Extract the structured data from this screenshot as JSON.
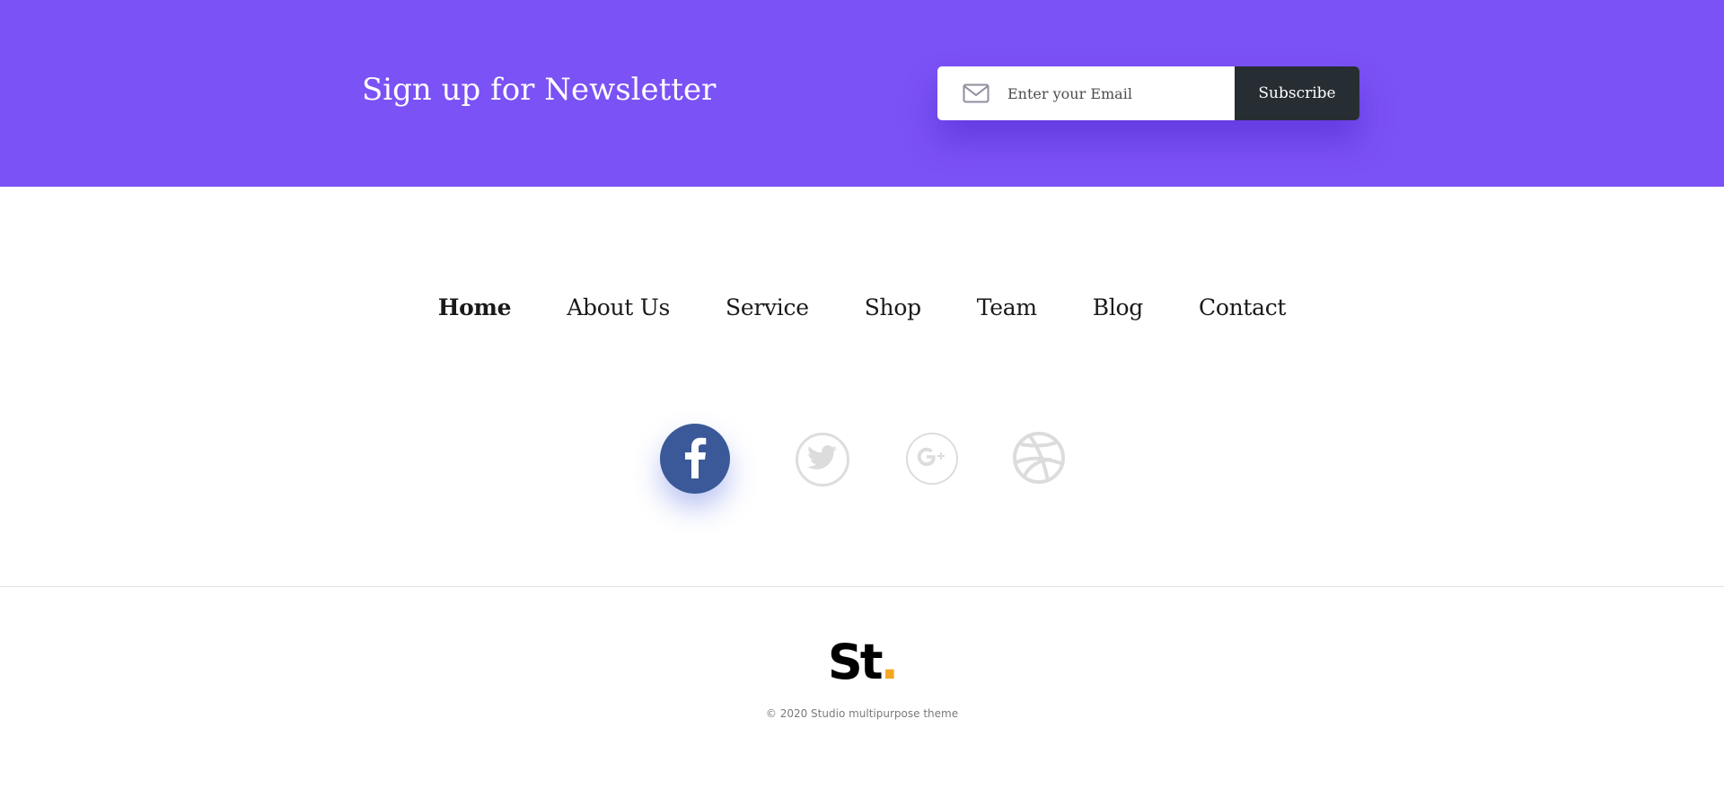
{
  "newsletter": {
    "title": "Sign up for Newsletter",
    "email_placeholder": "Enter your Email",
    "email_value": "",
    "subscribe_label": "Subscribe",
    "background_color": "#7b52f5",
    "button_color": "#262d33"
  },
  "nav": {
    "items": [
      {
        "label": "Home",
        "active": true
      },
      {
        "label": "About Us",
        "active": false
      },
      {
        "label": "Service",
        "active": false
      },
      {
        "label": "Shop",
        "active": false
      },
      {
        "label": "Team",
        "active": false
      },
      {
        "label": "Blog",
        "active": false
      },
      {
        "label": "Contact",
        "active": false
      }
    ]
  },
  "social": {
    "icons": [
      "facebook-icon",
      "twitter-icon",
      "google-plus-icon",
      "dribbble-icon"
    ],
    "facebook_color": "#3b5998"
  },
  "footer": {
    "logo_text": "St",
    "logo_dot": ".",
    "logo_dot_color": "#f5a623",
    "copyright": "© 2020 Studio multipurpose theme"
  }
}
